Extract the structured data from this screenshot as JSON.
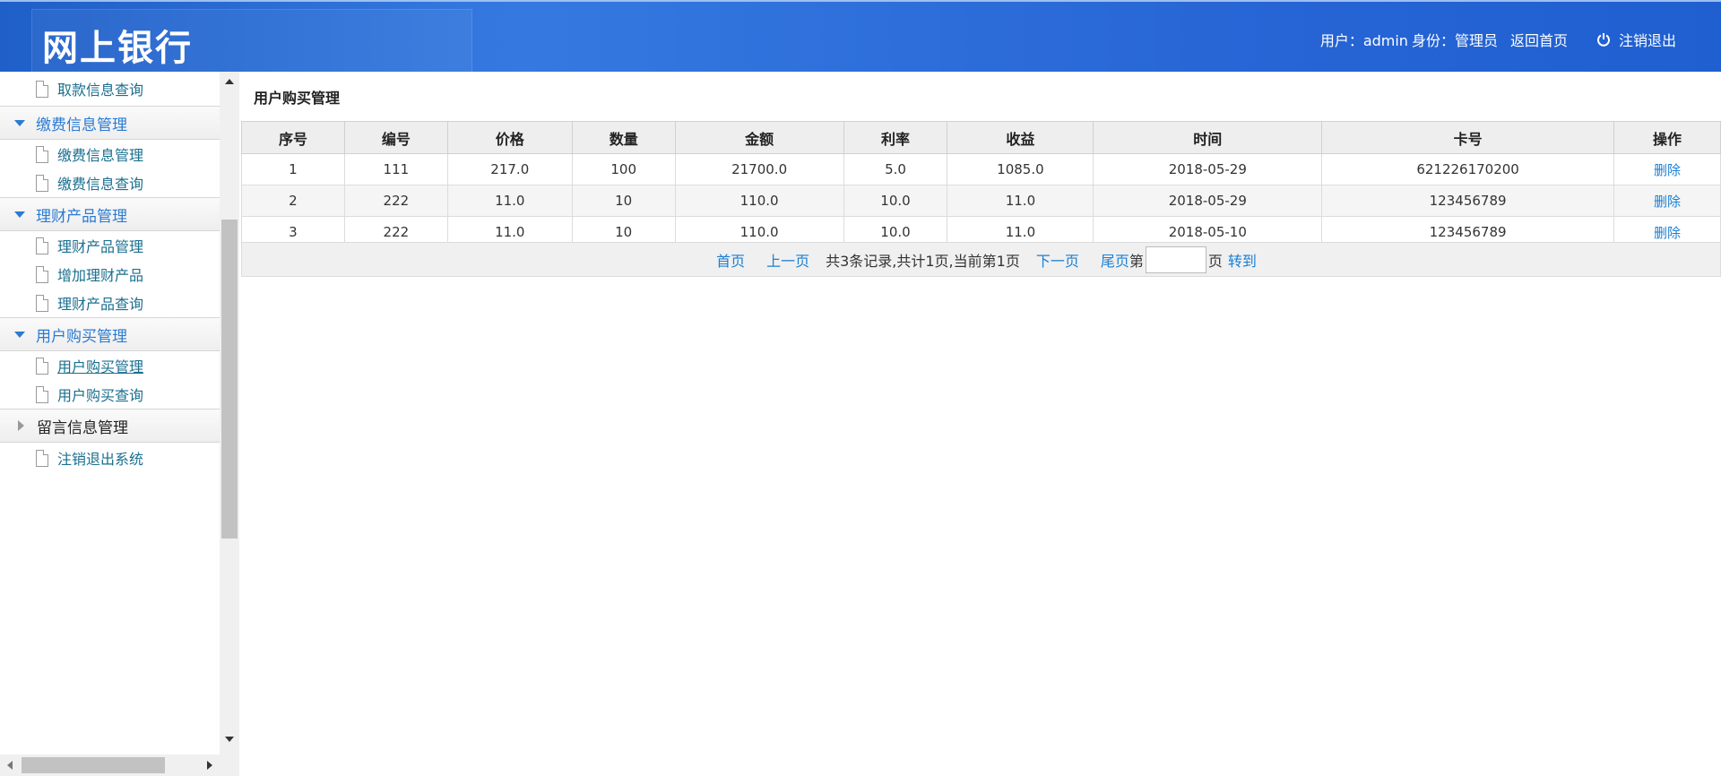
{
  "header": {
    "logo": "网上银行",
    "user_prefix": "用户：admin",
    "role_text": "身份：管理员",
    "home_link": "返回首页",
    "logout": "注销退出"
  },
  "sidebar": {
    "top_item": "取款信息查询",
    "groups": [
      {
        "label": "缴费信息管理",
        "expanded": true,
        "items": [
          "缴费信息管理",
          "缴费信息查询"
        ]
      },
      {
        "label": "理财产品管理",
        "expanded": true,
        "items": [
          "理财产品管理",
          "增加理财产品",
          "理财产品查询"
        ]
      },
      {
        "label": "用户购买管理",
        "expanded": true,
        "items": [
          "用户购买管理",
          "用户购买查询"
        ]
      },
      {
        "label": "留言信息管理",
        "expanded": false,
        "items": [
          "注销退出系统"
        ]
      }
    ]
  },
  "main": {
    "title": "用户购买管理",
    "columns": [
      "序号",
      "编号",
      "价格",
      "数量",
      "金额",
      "利率",
      "收益",
      "时间",
      "卡号",
      "操作"
    ],
    "rows": [
      [
        "1",
        "111",
        "217.0",
        "100",
        "21700.0",
        "5.0",
        "1085.0",
        "2018-05-29",
        "621226170200",
        "删除"
      ],
      [
        "2",
        "222",
        "11.0",
        "10",
        "110.0",
        "10.0",
        "11.0",
        "2018-05-29",
        "123456789",
        "删除"
      ],
      [
        "3",
        "222",
        "11.0",
        "10",
        "110.0",
        "10.0",
        "11.0",
        "2018-05-10",
        "123456789",
        "删除"
      ]
    ],
    "pager": {
      "first": "首页",
      "prev": "上一页",
      "summary": "共3条记录,共计1页,当前第1页",
      "next": "下一页",
      "last": "尾页",
      "page_prefix": "第",
      "page_suffix": "页",
      "go": "转到"
    }
  },
  "colors": {
    "header_blue": "#2866d6",
    "link_blue": "#1a7fd4",
    "sidebar_text": "#1a6f8f"
  }
}
